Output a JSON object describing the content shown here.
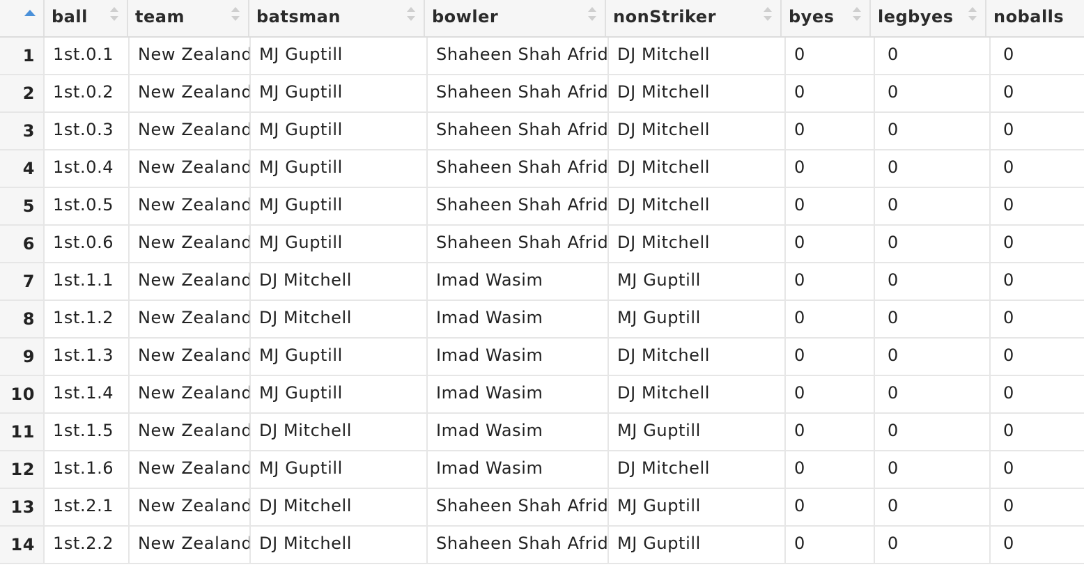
{
  "table": {
    "columns": [
      {
        "key": "ball",
        "label": "ball"
      },
      {
        "key": "team",
        "label": "team"
      },
      {
        "key": "batsman",
        "label": "batsman"
      },
      {
        "key": "bowler",
        "label": "bowler"
      },
      {
        "key": "nonStriker",
        "label": "nonStriker"
      },
      {
        "key": "byes",
        "label": "byes"
      },
      {
        "key": "legbyes",
        "label": "legbyes"
      },
      {
        "key": "noballs",
        "label": "noballs"
      }
    ],
    "rows": [
      {
        "n": "1",
        "cells": [
          "1st.0.1",
          "New Zealand",
          "MJ Guptill",
          "Shaheen Shah Afridi",
          "DJ Mitchell",
          "0",
          "0",
          "0"
        ]
      },
      {
        "n": "2",
        "cells": [
          "1st.0.2",
          "New Zealand",
          "MJ Guptill",
          "Shaheen Shah Afridi",
          "DJ Mitchell",
          "0",
          "0",
          "0"
        ]
      },
      {
        "n": "3",
        "cells": [
          "1st.0.3",
          "New Zealand",
          "MJ Guptill",
          "Shaheen Shah Afridi",
          "DJ Mitchell",
          "0",
          "0",
          "0"
        ]
      },
      {
        "n": "4",
        "cells": [
          "1st.0.4",
          "New Zealand",
          "MJ Guptill",
          "Shaheen Shah Afridi",
          "DJ Mitchell",
          "0",
          "0",
          "0"
        ]
      },
      {
        "n": "5",
        "cells": [
          "1st.0.5",
          "New Zealand",
          "MJ Guptill",
          "Shaheen Shah Afridi",
          "DJ Mitchell",
          "0",
          "0",
          "0"
        ]
      },
      {
        "n": "6",
        "cells": [
          "1st.0.6",
          "New Zealand",
          "MJ Guptill",
          "Shaheen Shah Afridi",
          "DJ Mitchell",
          "0",
          "0",
          "0"
        ]
      },
      {
        "n": "7",
        "cells": [
          "1st.1.1",
          "New Zealand",
          "DJ Mitchell",
          "Imad Wasim",
          "MJ Guptill",
          "0",
          "0",
          "0"
        ]
      },
      {
        "n": "8",
        "cells": [
          "1st.1.2",
          "New Zealand",
          "DJ Mitchell",
          "Imad Wasim",
          "MJ Guptill",
          "0",
          "0",
          "0"
        ]
      },
      {
        "n": "9",
        "cells": [
          "1st.1.3",
          "New Zealand",
          "MJ Guptill",
          "Imad Wasim",
          "DJ Mitchell",
          "0",
          "0",
          "0"
        ]
      },
      {
        "n": "10",
        "cells": [
          "1st.1.4",
          "New Zealand",
          "MJ Guptill",
          "Imad Wasim",
          "DJ Mitchell",
          "0",
          "0",
          "0"
        ]
      },
      {
        "n": "11",
        "cells": [
          "1st.1.5",
          "New Zealand",
          "DJ Mitchell",
          "Imad Wasim",
          "MJ Guptill",
          "0",
          "0",
          "0"
        ]
      },
      {
        "n": "12",
        "cells": [
          "1st.1.6",
          "New Zealand",
          "MJ Guptill",
          "Imad Wasim",
          "DJ Mitchell",
          "0",
          "0",
          "0"
        ]
      },
      {
        "n": "13",
        "cells": [
          "1st.2.1",
          "New Zealand",
          "DJ Mitchell",
          "Shaheen Shah Afridi",
          "MJ Guptill",
          "0",
          "0",
          "0"
        ]
      },
      {
        "n": "14",
        "cells": [
          "1st.2.2",
          "New Zealand",
          "DJ Mitchell",
          "Shaheen Shah Afridi",
          "MJ Guptill",
          "0",
          "0",
          "0"
        ]
      }
    ]
  },
  "colors": {
    "header_bg": "#f6f6f6",
    "sort_accent": "#4a90d9",
    "grid_line": "#e6e6e6"
  },
  "icons": {
    "sort_active": "sort-ascending-icon",
    "sort_inactive": "sort-arrows-icon"
  }
}
